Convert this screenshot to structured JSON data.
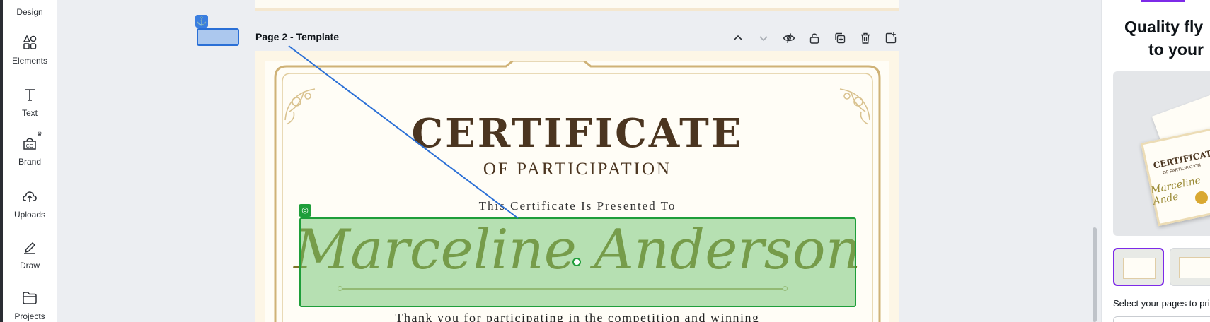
{
  "sidebar": {
    "items": [
      {
        "label": "Design",
        "icon": "design-icon"
      },
      {
        "label": "Elements",
        "icon": "elements-icon"
      },
      {
        "label": "Text",
        "icon": "text-icon"
      },
      {
        "label": "Brand",
        "icon": "brand-icon"
      },
      {
        "label": "Uploads",
        "icon": "uploads-icon"
      },
      {
        "label": "Draw",
        "icon": "draw-icon"
      },
      {
        "label": "Projects",
        "icon": "projects-icon"
      }
    ]
  },
  "page": {
    "title": "Page 2 - Template",
    "tools": [
      "chevron-up-icon",
      "chevron-down-icon",
      "hide-icon",
      "lock-icon",
      "duplicate-icon",
      "trash-icon",
      "add-page-icon"
    ]
  },
  "certificate": {
    "title": "CERTIFICATE",
    "subtitle": "OF PARTICIPATION",
    "presented": "This Certificate Is Presented To",
    "name": "Marceline Anderson",
    "thanks": "Thank you for participating in the competition and winning"
  },
  "right_panel": {
    "heading_line1": "Quality fly",
    "heading_line2": "to your",
    "promo_title": "CERTIFICATE",
    "promo_subtitle": "OF PARTICIPATION",
    "promo_name": "Marceline Ande",
    "footer_text": "Select your pages to pri"
  },
  "colors": {
    "accent": "#7d2ae8",
    "selection_blue": "#2a6fd6",
    "selection_green": "#1e9e3a",
    "cert_brown": "#4b3520",
    "cert_gold": "#cfb277"
  }
}
